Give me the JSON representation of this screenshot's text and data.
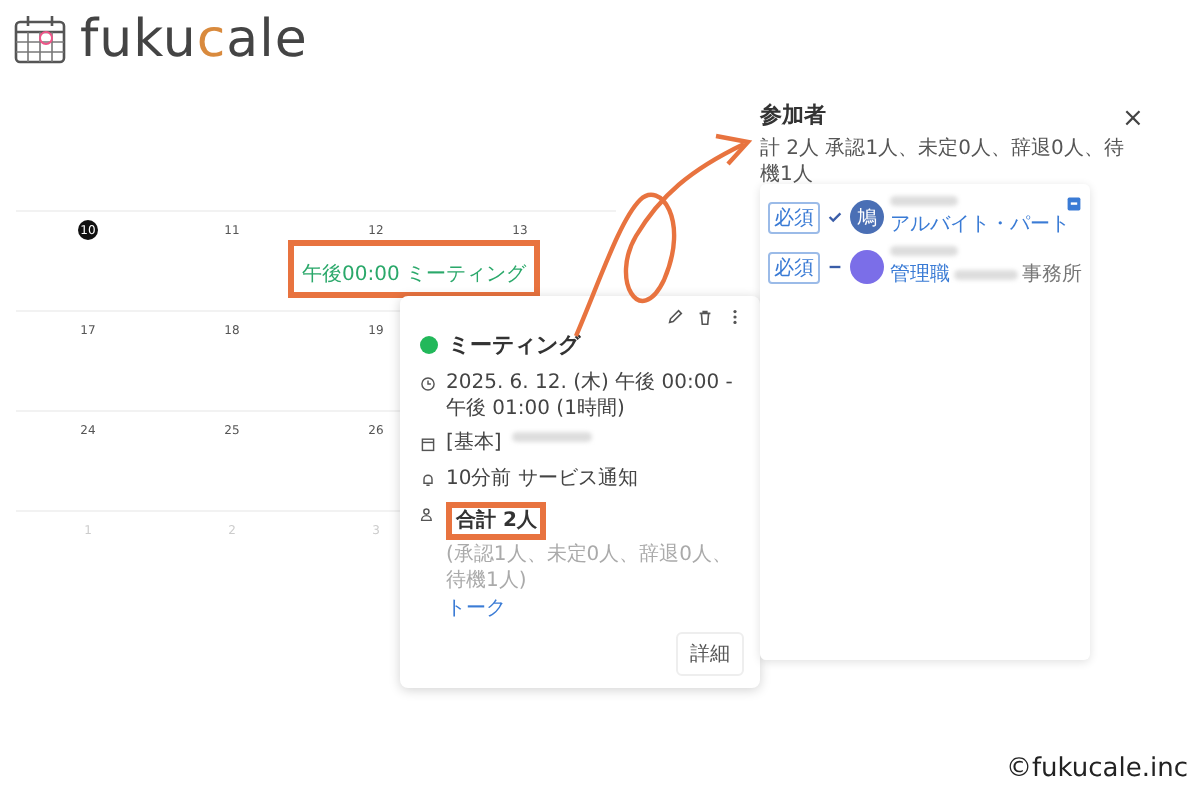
{
  "logo": {
    "parts": [
      {
        "text": "fuku",
        "accent": false
      },
      {
        "text": "c",
        "accent": true
      },
      {
        "text": "ale",
        "accent": false
      }
    ]
  },
  "calendar": {
    "weeks": [
      [
        {
          "day": "10",
          "today": true,
          "other_month": false
        },
        {
          "day": "11",
          "today": false,
          "other_month": false
        },
        {
          "day": "12",
          "today": false,
          "other_month": false,
          "event": {
            "time": "午後00:00",
            "title": "ミーティング",
            "highlighted": true
          }
        },
        {
          "day": "13",
          "today": false,
          "other_month": false
        }
      ],
      [
        {
          "day": "17",
          "today": false,
          "other_month": false
        },
        {
          "day": "18",
          "today": false,
          "other_month": false
        },
        {
          "day": "19",
          "today": false,
          "other_month": false
        }
      ],
      [
        {
          "day": "24",
          "today": false,
          "other_month": false
        },
        {
          "day": "25",
          "today": false,
          "other_month": false
        },
        {
          "day": "26",
          "today": false,
          "other_month": false
        }
      ],
      [
        {
          "day": "1",
          "today": false,
          "other_month": true
        },
        {
          "day": "2",
          "today": false,
          "other_month": true
        },
        {
          "day": "3",
          "today": false,
          "other_month": true
        }
      ]
    ]
  },
  "popup": {
    "title": "ミーティング",
    "color": "#22b85a",
    "datetime": "2025. 6. 12. (木) 午後 00:00 - 午後 01:00 (1時間)",
    "calendar": "[基本]",
    "reminder": "10分前 サービス通知",
    "participants": {
      "total": "合計 2人",
      "detail": "(承認1人、未定0人、辞退0人、待機1人)",
      "link": "トーク",
      "highlighted": true
    },
    "button": "詳細"
  },
  "panel": {
    "title": "参加者",
    "close": "×",
    "summary": "計 2人 承認1人、未定0人、辞退0人、待機1人",
    "attendees": [
      {
        "badge": "必須",
        "accepted": true,
        "avatar": "鳩",
        "color": "#4a6fb5",
        "role": "アルバイト・パート"
      },
      {
        "badge": "必須",
        "accepted": false,
        "color": "#7b6ee8",
        "role": "管理職",
        "place": "事務所"
      }
    ]
  },
  "copyright": "©fukucale.inc"
}
